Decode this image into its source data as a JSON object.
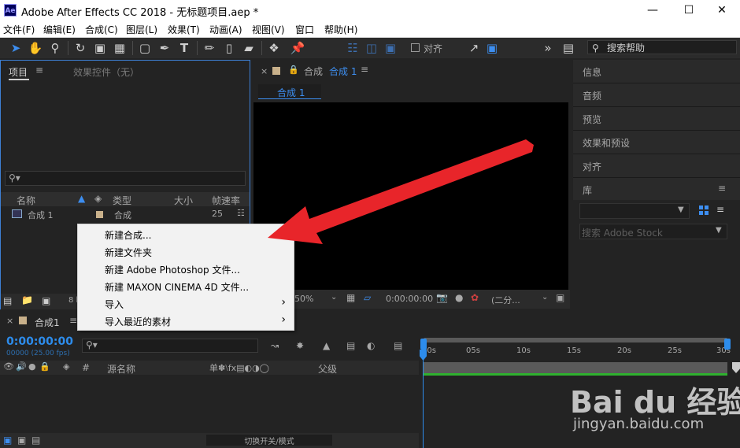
{
  "window": {
    "title": "Adobe After Effects CC 2018 - 无标题项目.aep *",
    "app_icon": "Ae",
    "controls": [
      "minimize-icon",
      "maximize-icon",
      "close-icon"
    ]
  },
  "menubar": [
    "文件(F)",
    "编辑(E)",
    "合成(C)",
    "图层(L)",
    "效果(T)",
    "动画(A)",
    "视图(V)",
    "窗口",
    "帮助(H)"
  ],
  "toolbar": {
    "align_label": "对齐",
    "search_help_placeholder": "搜索帮助"
  },
  "project_panel": {
    "tab_project": "项目",
    "tab_effects": "效果控件（无）",
    "columns": [
      "名称",
      "类型",
      "大小",
      "帧速率"
    ],
    "items": [
      {
        "name": "合成 1",
        "type": "合成",
        "size": "",
        "fps": "25"
      }
    ],
    "bpc": "8 b"
  },
  "comp_viewer": {
    "tab_label": "合成",
    "comp_name": "合成 1",
    "breadcrumb": "合成 1",
    "zoom": "50%",
    "timecode": "0:00:00:00",
    "resolution": "(二分..."
  },
  "right_panel": {
    "items": [
      "信息",
      "音频",
      "预览",
      "效果和预设",
      "对齐",
      "库"
    ],
    "stock_search_placeholder": "搜索 Adobe Stock"
  },
  "timeline": {
    "tab_label": "合成1",
    "timecode": "0:00:00:00",
    "frame_info": "00000 (25.00 fps)",
    "columns": [
      "#",
      "源名称",
      "父级"
    ],
    "ruler": [
      "00s",
      "05s",
      "10s",
      "15s",
      "20s",
      "25s",
      "30s"
    ],
    "toggle_label": "切换开关/模式",
    "accent_color": "#2d8ceb"
  },
  "context_menu": {
    "items": [
      {
        "label": "新建合成...",
        "submenu": false
      },
      {
        "label": "新建文件夹",
        "submenu": false
      },
      {
        "label": "新建 Adobe Photoshop 文件...",
        "submenu": false
      },
      {
        "label": "新建 MAXON CINEMA 4D 文件...",
        "submenu": false
      },
      {
        "label": "导入",
        "submenu": true
      },
      {
        "label": "导入最近的素材",
        "submenu": true
      }
    ]
  },
  "watermark": {
    "brand": "Bai du 经验",
    "url": "jingyan.baidu.com"
  },
  "annotation": {
    "arrow_color": "#e8252a"
  }
}
